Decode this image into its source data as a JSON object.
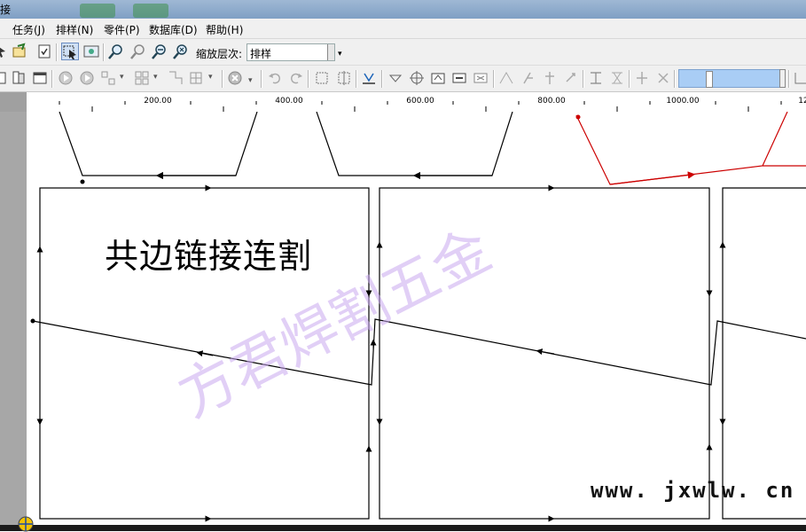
{
  "window": {
    "title": "接"
  },
  "menu": {
    "items": [
      "任务(J)",
      "排样(N)",
      "零件(P)",
      "数据库(D)",
      "帮助(H)"
    ]
  },
  "toolbar": {
    "zoom_label": "缩放层次:",
    "zoom_value": "排样",
    "icons_row1": [
      "pointer-icon",
      "open-icon",
      "check-icon",
      "select-icon",
      "map-icon",
      "zoom-in-icon",
      "zoom-fit-icon",
      "zoom-out-icon",
      "zoom-reset-icon"
    ],
    "icons_row2": [
      "part-icon",
      "cut-icon",
      "window-icon",
      "play-icon",
      "play-alt-icon",
      "grid-icon",
      "array-icon",
      "move-icon",
      "stop-icon",
      "undo-icon",
      "redo-icon",
      "align-icon",
      "mirror-icon",
      "sort-icon",
      "tool1-icon",
      "tool2-icon",
      "tool3-icon",
      "tool4-icon",
      "tool5-icon"
    ]
  },
  "ruler": {
    "labels": [
      "200.00",
      "400.00",
      "600.00",
      "800.00",
      "1000.00",
      "12"
    ]
  },
  "canvas": {
    "title": "共边链接连割",
    "watermark": "方君焊割五金",
    "url": "www. jxwlw. cn"
  },
  "colors": {
    "menubar": "#f0f0f0",
    "ruler_corner": "#a0a0a0",
    "path_black": "#000000",
    "path_red": "#cc0000",
    "watermark": "#c9a8f0",
    "blue_field": "#a9cdf5"
  }
}
